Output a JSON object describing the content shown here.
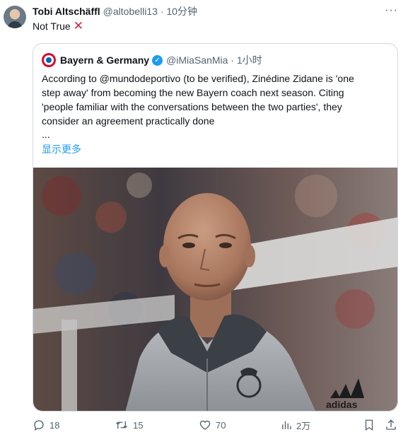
{
  "tweet": {
    "author_name": "Tobi Altschäffl",
    "author_meta": "@altobelli13 · 10分钟",
    "text": "Not True",
    "text_emoji": "✕"
  },
  "quote": {
    "author_name": "Bayern & Germany",
    "author_meta": "@iMiaSanMia · 1小时",
    "text_lines": [
      "According to @mundodeportivo (to be verified), Zinédine Zidane is 'one",
      "step away' from becoming the new Bayern coach next season. Citing",
      "'people familiar with the conversations between the two parties', they",
      "consider an agreement practically done"
    ],
    "ellipsis": "...",
    "show_more": "显示更多",
    "image_icon": "coach-photo"
  },
  "actions": {
    "replies": "18",
    "retweets": "15",
    "likes": "70",
    "views": "2万"
  },
  "colors": {
    "accent": "#1d9bf0",
    "secondary_text": "#536471",
    "border": "#cfd9de",
    "x_mark": "#d2283c"
  }
}
